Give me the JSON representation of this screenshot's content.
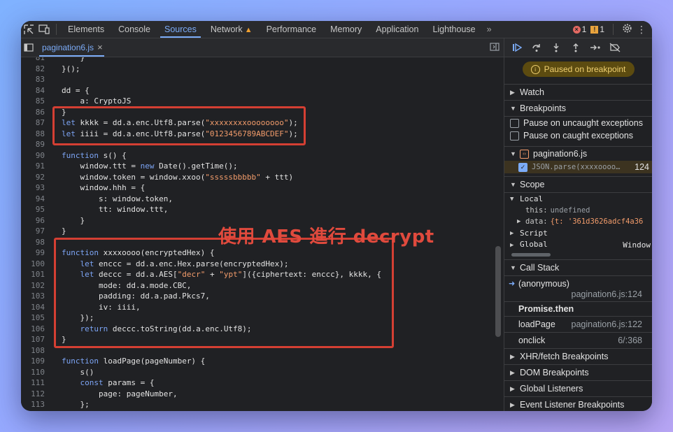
{
  "topbar": {
    "tabs": [
      "Elements",
      "Console",
      "Sources",
      "Network",
      "Performance",
      "Memory",
      "Application",
      "Lighthouse"
    ],
    "active_tab": "Sources",
    "more_label": "»",
    "error_count": "1",
    "warning_count": "1"
  },
  "editor": {
    "file_name": "pagination6.js",
    "annotation": "使用 AES 進行 decrypt"
  },
  "debugger": {
    "paused_label": "Paused on breakpoint",
    "watch": "Watch",
    "breakpoints": "Breakpoints",
    "pause_uncaught": "Pause on uncaught exceptions",
    "pause_caught": "Pause on caught exceptions",
    "bp_file": "pagination6.js",
    "bp_code": "JSON.parse(xxxxoooo…",
    "bp_line": "124",
    "scope": "Scope",
    "local": "Local",
    "this_key": "this:",
    "this_val": "undefined",
    "data_key": "data:",
    "data_val": "{t: '361d3626adcf4a36",
    "script": "Script",
    "global": "Global",
    "global_val": "Window",
    "call_stack": "Call Stack",
    "frames": [
      {
        "name": "(anonymous)",
        "loc": "pagination6.js:124"
      },
      {
        "name": "Promise.then",
        "loc": ""
      },
      {
        "name": "loadPage",
        "loc": "pagination6.js:122"
      },
      {
        "name": "onclick",
        "loc": "6/:368"
      }
    ],
    "xhr": "XHR/fetch Breakpoints",
    "dom": "DOM Breakpoints",
    "global_listeners": "Global Listeners",
    "event_listener": "Event Listener Breakpoints"
  },
  "code_lines": [
    {
      "n": "81",
      "t": "    }"
    },
    {
      "n": "82",
      "t": "}();"
    },
    {
      "n": "83",
      "t": ""
    },
    {
      "n": "84",
      "t": "dd = {"
    },
    {
      "n": "85",
      "t": "    a: CryptoJS"
    },
    {
      "n": "86",
      "t": "}"
    },
    {
      "n": "87",
      "t": "let kkkk = dd.a.enc.Utf8.parse(\"xxxxxxxxoooooooo\");"
    },
    {
      "n": "88",
      "t": "let iiii = dd.a.enc.Utf8.parse(\"0123456789ABCDEF\");"
    },
    {
      "n": "89",
      "t": ""
    },
    {
      "n": "90",
      "t": "function s() {"
    },
    {
      "n": "91",
      "t": "    window.ttt = new Date().getTime();"
    },
    {
      "n": "92",
      "t": "    window.token = window.xxoo(\"sssssbbbbb\" + ttt)"
    },
    {
      "n": "93",
      "t": "    window.hhh = {"
    },
    {
      "n": "94",
      "t": "        s: window.token,"
    },
    {
      "n": "95",
      "t": "        tt: window.ttt,"
    },
    {
      "n": "96",
      "t": "    }"
    },
    {
      "n": "97",
      "t": "}"
    },
    {
      "n": "98",
      "t": ""
    },
    {
      "n": "99",
      "t": "function xxxxoooo(encryptedHex) {"
    },
    {
      "n": "100",
      "t": "    let enccc = dd.a.enc.Hex.parse(encryptedHex);"
    },
    {
      "n": "101",
      "t": "    let deccc = dd.a.AES[\"decr\" + \"ypt\"]({ciphertext: enccc}, kkkk, {"
    },
    {
      "n": "102",
      "t": "        mode: dd.a.mode.CBC,"
    },
    {
      "n": "103",
      "t": "        padding: dd.a.pad.Pkcs7,"
    },
    {
      "n": "104",
      "t": "        iv: iiii,"
    },
    {
      "n": "105",
      "t": "    });"
    },
    {
      "n": "106",
      "t": "    return deccc.toString(dd.a.enc.Utf8);"
    },
    {
      "n": "107",
      "t": "}"
    },
    {
      "n": "108",
      "t": ""
    },
    {
      "n": "109",
      "t": "function loadPage(pageNumber) {"
    },
    {
      "n": "110",
      "t": "    s()"
    },
    {
      "n": "111",
      "t": "    const params = {"
    },
    {
      "n": "112",
      "t": "        page: pageNumber,"
    },
    {
      "n": "113",
      "t": "    };"
    }
  ]
}
